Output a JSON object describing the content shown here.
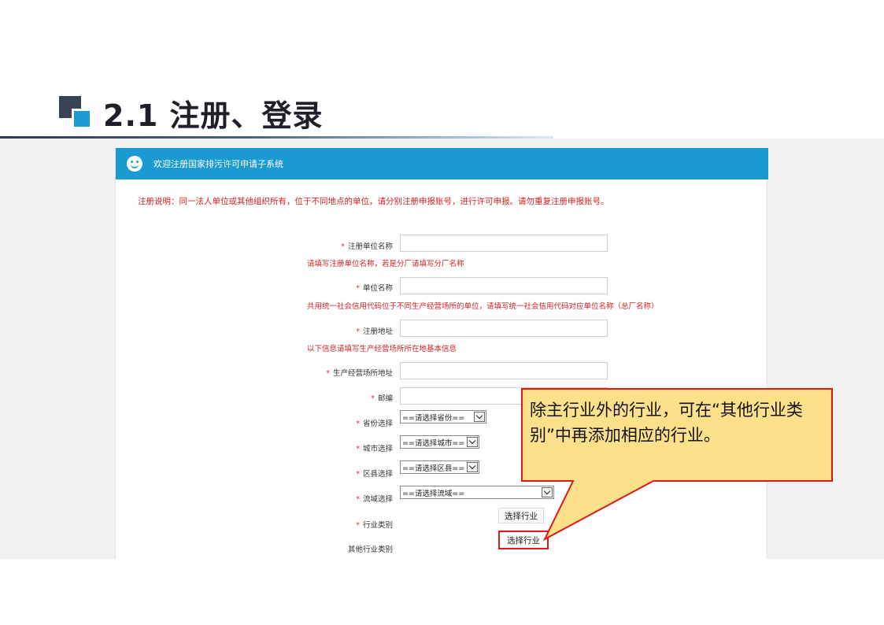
{
  "slide": {
    "title": "2.1  注册、登录"
  },
  "app": {
    "header_title": "欢迎注册国家排污许可申请子系统",
    "notice": "注册说明：同一法人单位或其他组织所有，位于不同地点的单位，请分别注册申报账号，进行许可申报。请勿重复注册申报账号。"
  },
  "form": {
    "fields": [
      {
        "label": "注册单位名称",
        "required": true,
        "value": "",
        "hint": "请填写注册单位名称，若是分厂请填写分厂名称"
      },
      {
        "label": "单位名称",
        "required": true,
        "value": "",
        "hint": "共用统一社会信用代码位于不同生产经营场所的单位，请填写统一社会信用代码对应单位名称（总厂名称）"
      },
      {
        "label": "注册地址",
        "required": true,
        "value": "",
        "hint": "以下信息请填写生产经营场所所在地基本信息"
      },
      {
        "label": "生产经营场所地址",
        "required": true,
        "value": ""
      },
      {
        "label": "邮编",
        "required": true,
        "value": ""
      }
    ],
    "selects": [
      {
        "label": "省份选择",
        "required": true,
        "selected": "==请选择省份=="
      },
      {
        "label": "城市选择",
        "required": true,
        "selected": "==请选择城市=="
      },
      {
        "label": "区县选择",
        "required": true,
        "selected": "==请选择区县=="
      },
      {
        "label": "流域选择",
        "required": true,
        "selected": "==请选择流域=="
      }
    ],
    "industry": {
      "label": "行业类别",
      "required": true,
      "button": "选择行业"
    },
    "other_industry": {
      "label": "其他行业类别",
      "required": false,
      "button": "选择行业"
    },
    "required_mark": "*"
  },
  "callout": {
    "text": "除主行业外的行业，可在“其他行业类别”中再添加相应的行业。",
    "fill_color": "#fde08a",
    "border_color": "#e01818"
  }
}
